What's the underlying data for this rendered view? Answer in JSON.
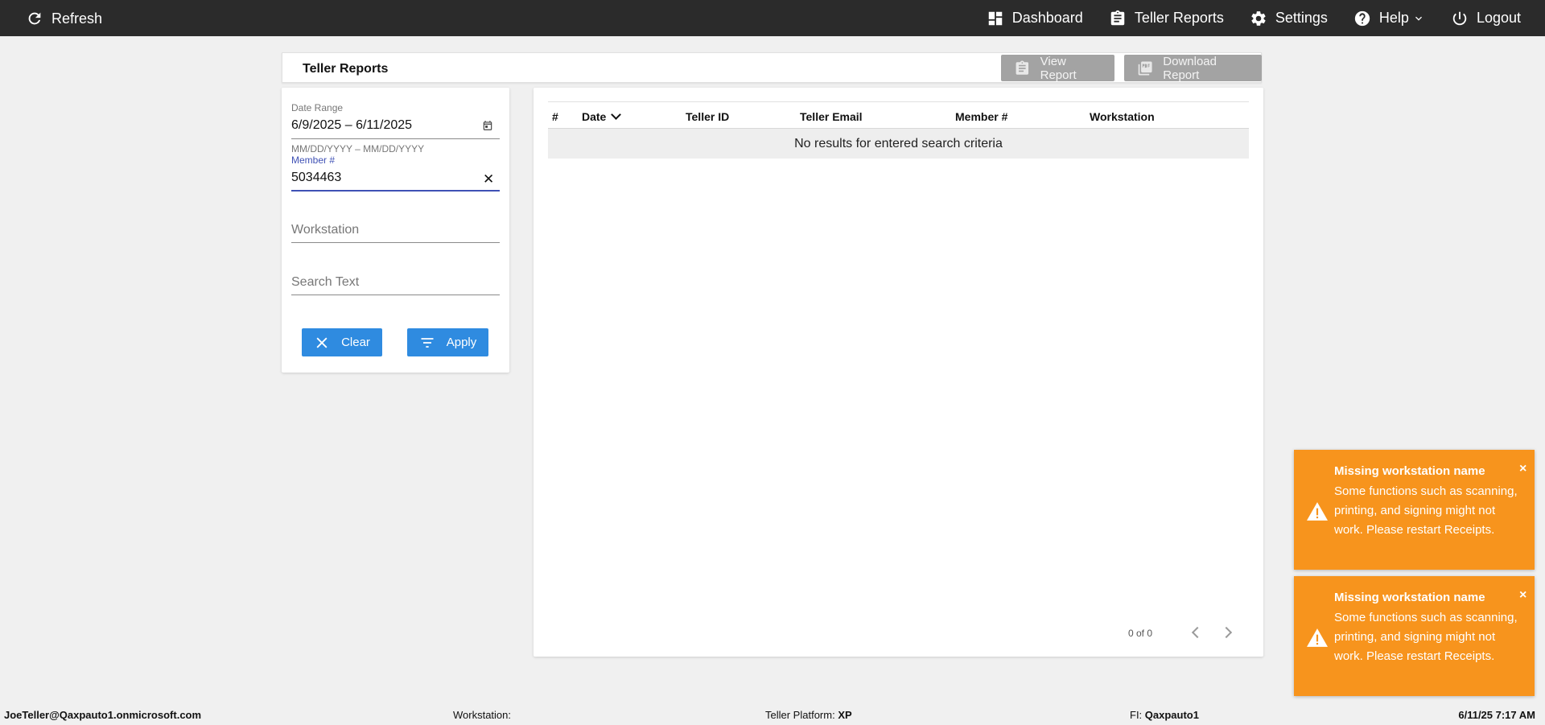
{
  "topbar": {
    "refresh_label": "Refresh",
    "nav": {
      "dashboard": "Dashboard",
      "teller_reports": "Teller Reports",
      "settings": "Settings",
      "help": "Help",
      "logout": "Logout"
    }
  },
  "header": {
    "title": "Teller Reports",
    "view_report": "View Report",
    "download_report": "Download Report"
  },
  "filters": {
    "date_range_label": "Date Range",
    "date_range_value": "6/9/2025 – 6/11/2025",
    "date_hint": "MM/DD/YYYY – MM/DD/YYYY",
    "member_label": "Member #",
    "member_value": "5034463",
    "workstation_placeholder": "Workstation",
    "search_placeholder": "Search Text",
    "clear_button": "Clear",
    "apply_button": "Apply"
  },
  "table": {
    "columns": [
      "#",
      "Date",
      "Teller ID",
      "Teller Email",
      "Member #",
      "Workstation"
    ],
    "sorted_column": "Date",
    "empty_message": "No results for entered search criteria",
    "pager": "0 of 0"
  },
  "toasts": [
    {
      "title": "Missing workstation name",
      "message": "Some functions such as scanning, printing, and signing might not work. Please restart Receipts.",
      "close": "×"
    },
    {
      "title": "Missing workstation name",
      "message": "Some functions such as scanning, printing, and signing might not work. Please restart Receipts.",
      "close": "×"
    }
  ],
  "statusbar": {
    "user": "JoeTeller@Qaxpauto1.onmicrosoft.com",
    "workstation_label": "Workstation:",
    "platform_label": "Teller Platform:",
    "platform_value": "XP",
    "fi_label": "FI:",
    "fi_value": "Qaxpauto1",
    "datetime": "6/11/25 7:17 AM"
  },
  "colors": {
    "topbar": "#2b2b2b",
    "primary_button": "#2f8be0",
    "disabled_button": "#a3a3a3",
    "toast": "#f7941d",
    "active_underline": "#3f51b5"
  }
}
